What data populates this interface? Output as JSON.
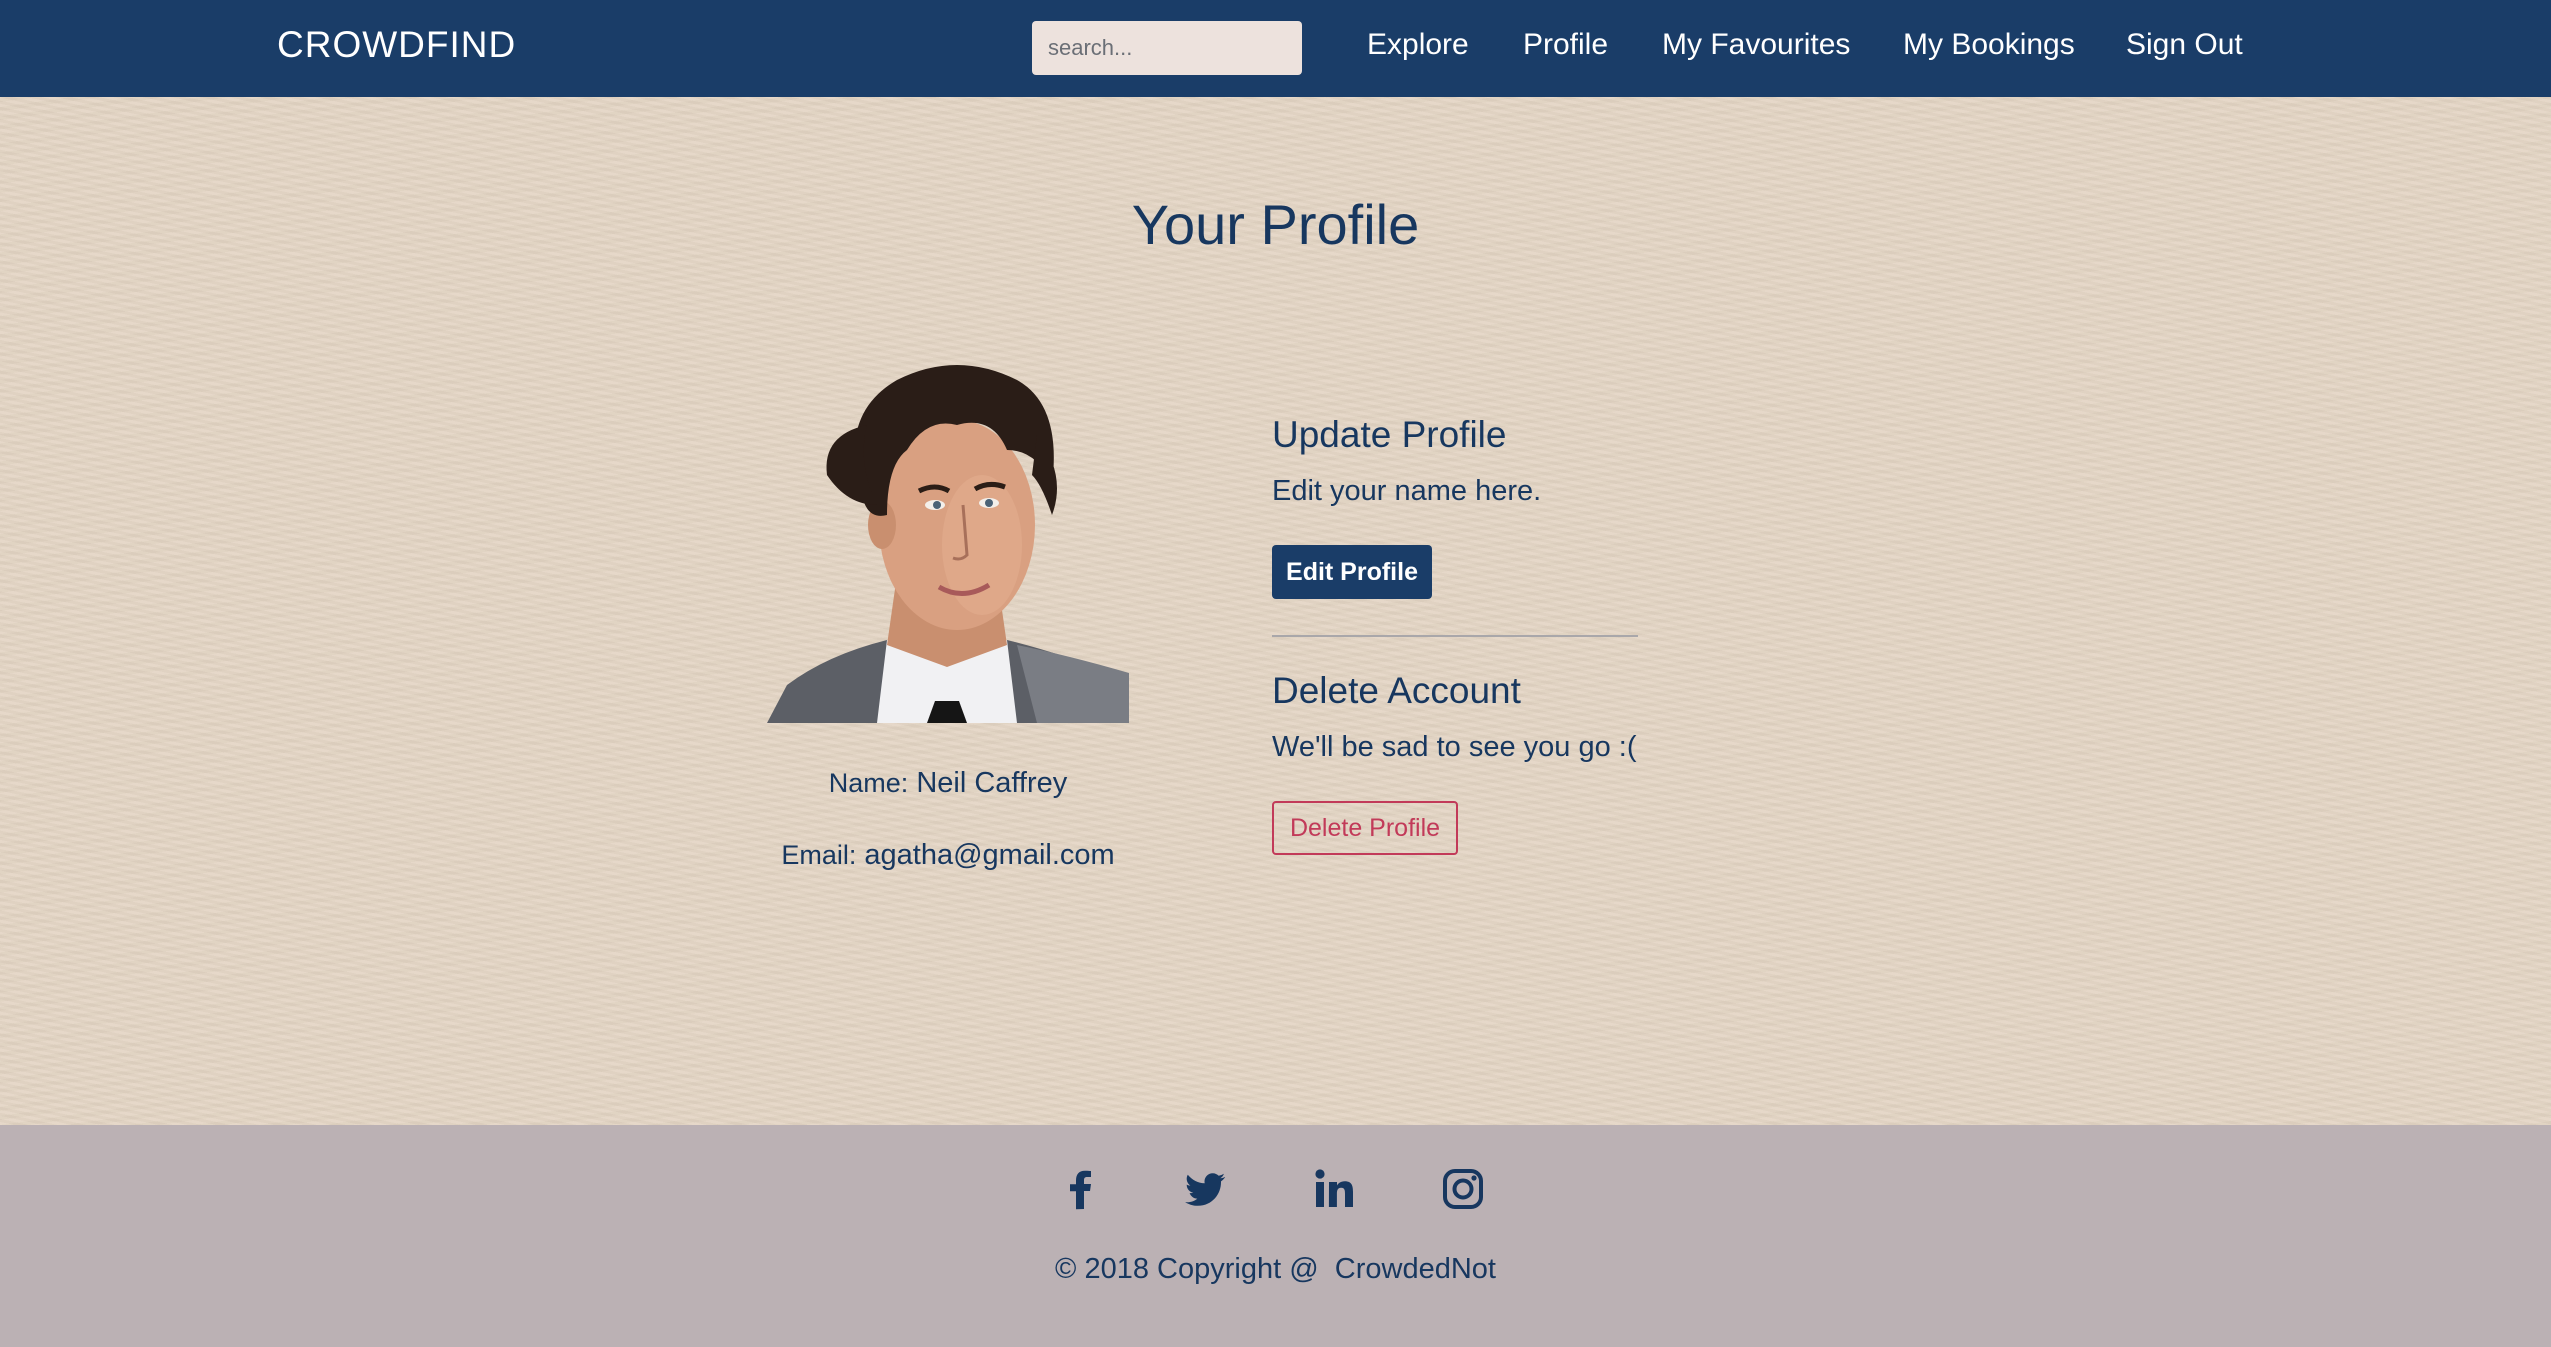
{
  "navbar": {
    "brand": "CROWDFIND",
    "search_placeholder": "search...",
    "links": {
      "explore": "Explore",
      "profile": "Profile",
      "favourites": "My Favourites",
      "bookings": "My Bookings",
      "sign_out": "Sign Out"
    }
  },
  "main": {
    "title": "Your Profile",
    "user": {
      "name_label": "Name:",
      "name": "Neil Caffrey",
      "email_label": "Email:",
      "email": "agatha@gmail.com"
    },
    "update": {
      "title": "Update Profile",
      "text": "Edit your name here.",
      "button": "Edit Profile"
    },
    "delete": {
      "title": "Delete Account",
      "text": "We'll be sad to see you go :(",
      "button": "Delete Profile"
    }
  },
  "footer": {
    "social_icons": [
      "facebook-icon",
      "twitter-icon",
      "linkedin-icon",
      "instagram-icon"
    ],
    "copyright": "© 2018 Copyright @  CrowdedNot"
  },
  "colors": {
    "navbar_bg": "#1a3d68",
    "page_bg": "#e4d6c5",
    "footer_bg": "#bbb1b4",
    "text_primary": "#17375f",
    "danger": "#c23a59"
  }
}
